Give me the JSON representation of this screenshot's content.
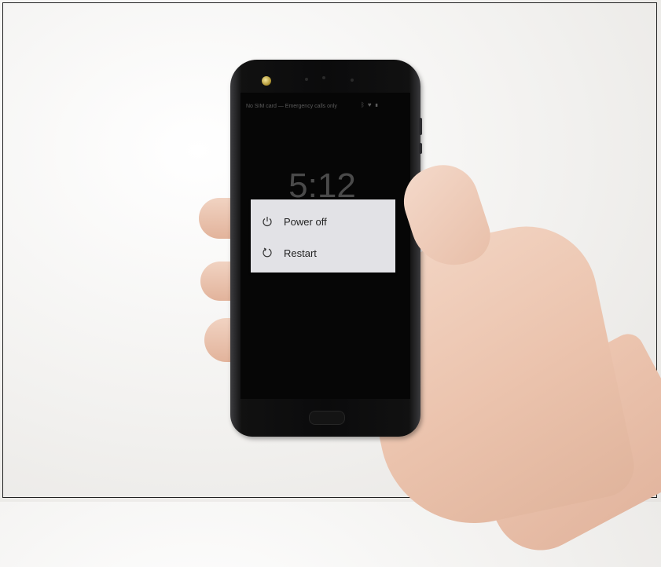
{
  "status_bar": {
    "carrier_text": "No SIM card — Emergency calls only",
    "icons": [
      "bluetooth-icon",
      "wifi-icon",
      "battery-icon"
    ]
  },
  "lock_screen": {
    "clock": "5:12"
  },
  "power_menu": {
    "items": [
      {
        "label": "Power off",
        "icon": "power-icon"
      },
      {
        "label": "Restart",
        "icon": "restart-icon"
      }
    ]
  },
  "colors": {
    "dialog_bg": "#e2e2e6",
    "screen_bg": "#060606",
    "text": "#222222"
  }
}
